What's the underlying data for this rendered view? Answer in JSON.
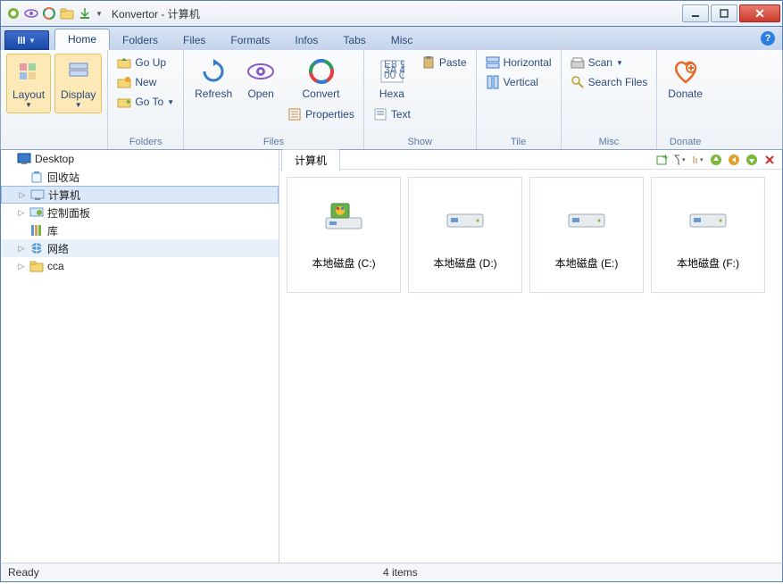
{
  "window": {
    "title": "Konvertor - 计算机"
  },
  "tabs": [
    "Home",
    "Folders",
    "Files",
    "Formats",
    "Infos",
    "Tabs",
    "Misc"
  ],
  "active_tab": "Home",
  "ribbon": {
    "layout": "Layout",
    "display": "Display",
    "go_up": "Go Up",
    "new": "New",
    "go_to": "Go To",
    "refresh": "Refresh",
    "open": "Open",
    "convert": "Convert",
    "properties": "Properties",
    "hexa": "Hexa",
    "paste": "Paste",
    "text": "Text",
    "horizontal": "Horizontal",
    "vertical": "Vertical",
    "scan": "Scan",
    "search": "Search Files",
    "donate": "Donate",
    "group_folders": "Folders",
    "group_files": "Files",
    "group_show": "Show",
    "group_tile": "Tile",
    "group_misc": "Misc",
    "group_donate": "Donate"
  },
  "tree": {
    "root": "Desktop",
    "items": [
      {
        "label": "回收站",
        "icon": "recycle"
      },
      {
        "label": "计算机",
        "icon": "computer",
        "expandable": true,
        "selected": true
      },
      {
        "label": "控制面板",
        "icon": "control",
        "expandable": true
      },
      {
        "label": "库",
        "icon": "library"
      },
      {
        "label": "网络",
        "icon": "network",
        "expandable": true,
        "sel2": true
      },
      {
        "label": "cca",
        "icon": "folder",
        "expandable": true
      }
    ]
  },
  "content": {
    "path": "计算机",
    "drives": [
      {
        "label": "本地磁盘 (C:)",
        "type": "system"
      },
      {
        "label": "本地磁盘 (D:)",
        "type": "disk"
      },
      {
        "label": "本地磁盘 (E:)",
        "type": "disk"
      },
      {
        "label": "本地磁盘 (F:)",
        "type": "disk"
      }
    ]
  },
  "status": {
    "ready": "Ready",
    "count": "4 items"
  }
}
